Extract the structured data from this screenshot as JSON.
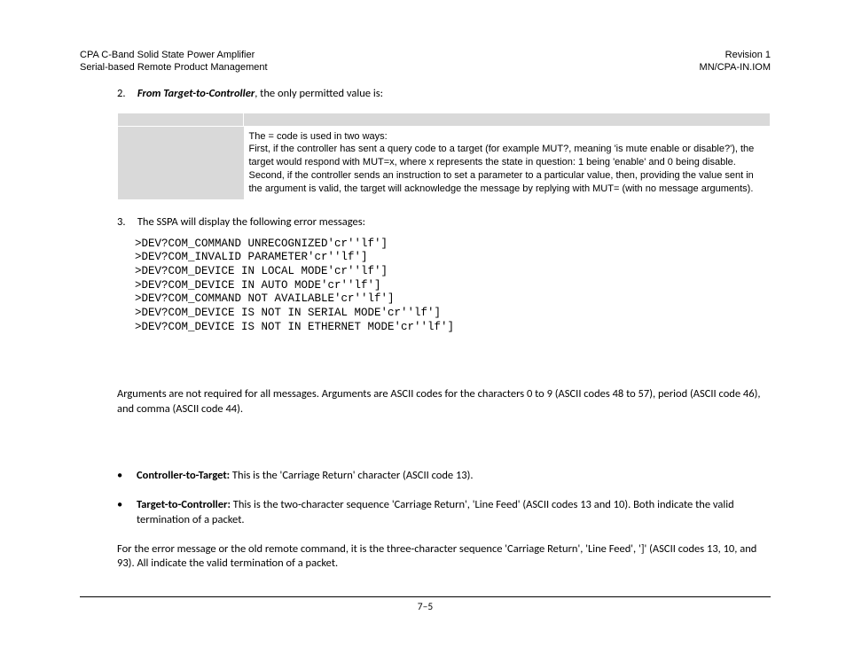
{
  "header": {
    "left1": "CPA C-Band Solid State Power Amplifier",
    "left2": "Serial-based Remote Product Management",
    "right1": "Revision 1",
    "right2": "MN/CPA-IN.IOM"
  },
  "item2": {
    "num": "2.",
    "lead": "From Target-to-Controller",
    "tail": ", the only permitted value is:"
  },
  "codebox": {
    "p1": "The = code is used in two ways:",
    "p2": "First, if the controller has sent a query code to a target (for example MUT?, meaning 'is mute enable or disable?'), the target would respond with MUT=x, where x represents the state in question: 1 being 'enable' and 0 being disable.",
    "p3": "Second, if the controller sends an instruction to set a parameter to a particular value, then, providing the value sent in the argument is valid, the target will acknowledge the message by replying with MUT= (with no message arguments)."
  },
  "item3": {
    "num": "3.",
    "text": "The SSPA will display the following error messages:"
  },
  "errors": ">DEV?COM_COMMAND UNRECOGNIZED'cr''lf']\n>DEV?COM_INVALID PARAMETER'cr''lf']\n>DEV?COM_DEVICE IN LOCAL MODE'cr''lf']\n>DEV?COM_DEVICE IN AUTO MODE'cr''lf']\n>DEV?COM_COMMAND NOT AVAILABLE'cr''lf']\n>DEV?COM_DEVICE IS NOT IN SERIAL MODE'cr''lf']\n>DEV?COM_DEVICE IS NOT IN ETHERNET MODE'cr''lf']",
  "args_para": "Arguments are not required for all messages. Arguments are ASCII codes for the characters 0 to 9 (ASCII codes 48 to 57), period (ASCII code 46), and comma (ASCII code 44).",
  "bullet1": {
    "lead": "Controller-to-Target:",
    "tail": " This is the 'Carriage Return' character (ASCII code 13)."
  },
  "bullet2": {
    "lead": "Target-to-Controller:",
    "tail": " This is the two-character sequence 'Carriage Return', 'Line Feed' (ASCII codes 13 and 10).  Both indicate the valid termination of a packet."
  },
  "closing": "For the error message or the old remote command, it is the three-character sequence 'Carriage Return', 'Line Feed', ']' (ASCII codes 13, 10, and 93). All indicate the valid termination of a packet.",
  "footer": "7–5"
}
